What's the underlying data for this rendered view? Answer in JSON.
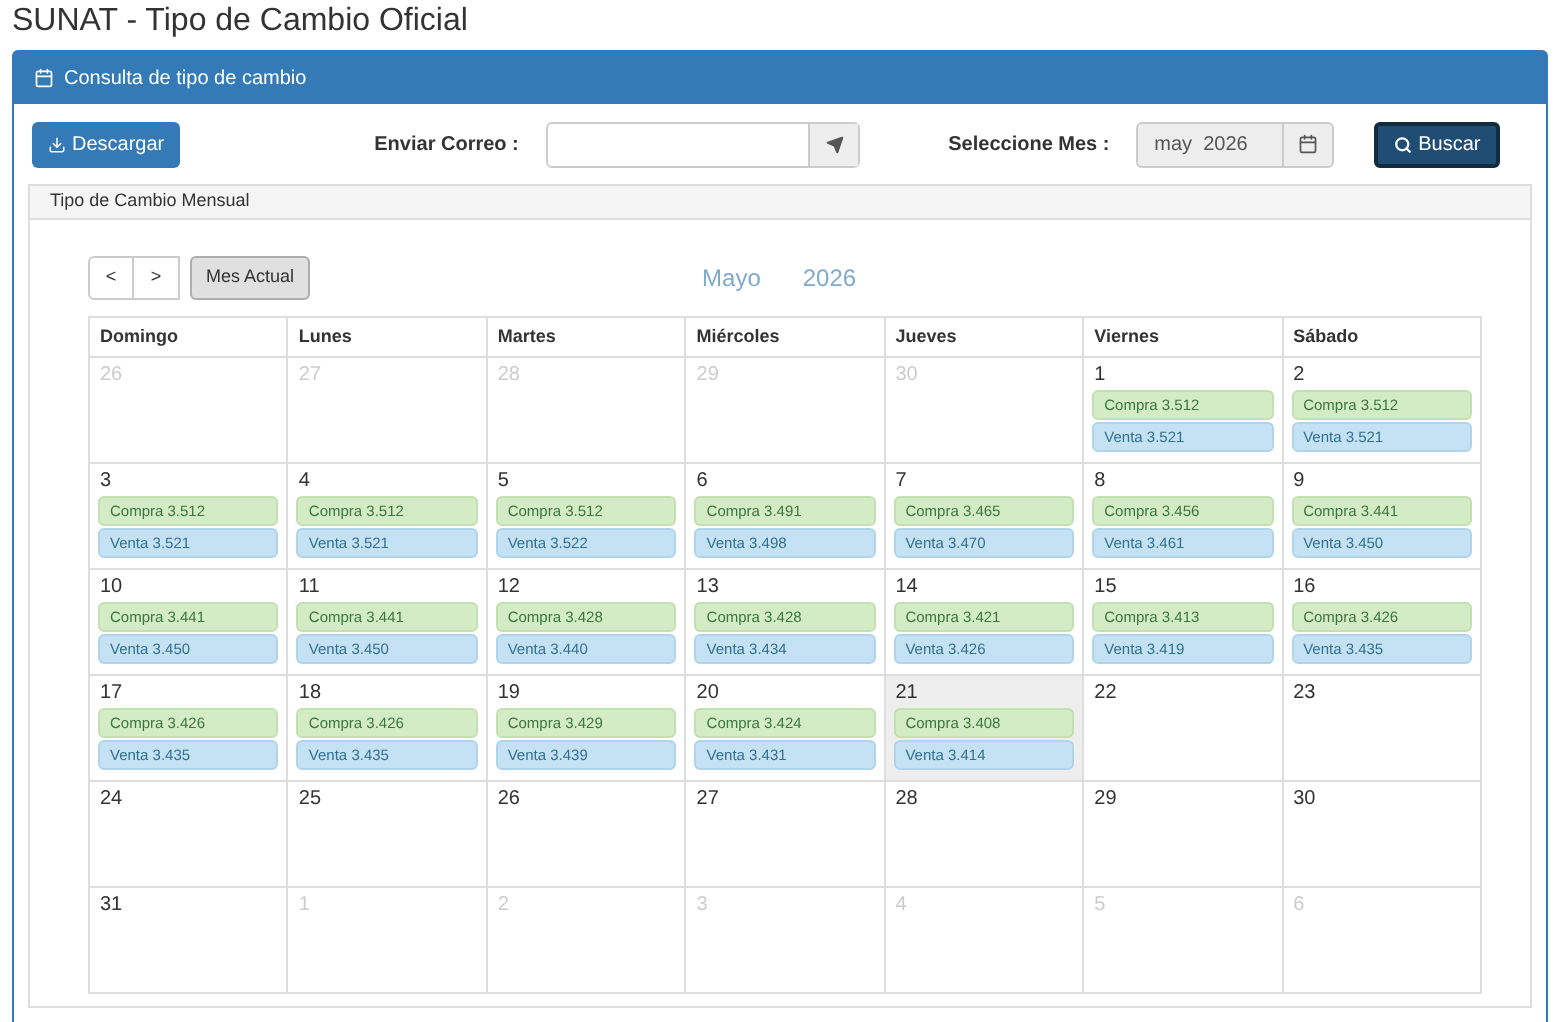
{
  "page_title": "SUNAT - Tipo de Cambio Oficial",
  "panel": {
    "title": "Consulta de tipo de cambio"
  },
  "toolbar": {
    "download_button": "Descargar",
    "email_label": "Enviar Correo :",
    "month_label": "Seleccione Mes :",
    "month_field": {
      "value": "may  2026"
    },
    "search_button": "Buscar"
  },
  "calendar_panel": {
    "title": "Tipo de Cambio Mensual",
    "nav": {
      "prev": "<",
      "next": ">",
      "today": "Mes Actual"
    },
    "month": "Mayo",
    "year": "2026",
    "weekdays": [
      "Domingo",
      "Lunes",
      "Martes",
      "Miércoles",
      "Jueves",
      "Viernes",
      "Sábado"
    ],
    "weeks": [
      [
        {
          "day": "26",
          "other": true,
          "selected": false
        },
        {
          "day": "27",
          "other": true,
          "selected": false
        },
        {
          "day": "28",
          "other": true,
          "selected": false
        },
        {
          "day": "29",
          "other": true,
          "selected": false
        },
        {
          "day": "30",
          "other": true,
          "selected": false
        },
        {
          "day": "1",
          "other": false,
          "selected": false,
          "compra": "Compra 3.512",
          "venta": "Venta 3.521"
        },
        {
          "day": "2",
          "other": false,
          "selected": false,
          "compra": "Compra 3.512",
          "venta": "Venta 3.521"
        }
      ],
      [
        {
          "day": "3",
          "other": false,
          "selected": false,
          "compra": "Compra 3.512",
          "venta": "Venta 3.521"
        },
        {
          "day": "4",
          "other": false,
          "selected": false,
          "compra": "Compra 3.512",
          "venta": "Venta 3.521"
        },
        {
          "day": "5",
          "other": false,
          "selected": false,
          "compra": "Compra 3.512",
          "venta": "Venta 3.522"
        },
        {
          "day": "6",
          "other": false,
          "selected": false,
          "compra": "Compra 3.491",
          "venta": "Venta 3.498"
        },
        {
          "day": "7",
          "other": false,
          "selected": false,
          "compra": "Compra 3.465",
          "venta": "Venta 3.470"
        },
        {
          "day": "8",
          "other": false,
          "selected": false,
          "compra": "Compra 3.456",
          "venta": "Venta 3.461"
        },
        {
          "day": "9",
          "other": false,
          "selected": false,
          "compra": "Compra 3.441",
          "venta": "Venta 3.450"
        }
      ],
      [
        {
          "day": "10",
          "other": false,
          "selected": false,
          "compra": "Compra 3.441",
          "venta": "Venta 3.450"
        },
        {
          "day": "11",
          "other": false,
          "selected": false,
          "compra": "Compra 3.441",
          "venta": "Venta 3.450"
        },
        {
          "day": "12",
          "other": false,
          "selected": false,
          "compra": "Compra 3.428",
          "venta": "Venta 3.440"
        },
        {
          "day": "13",
          "other": false,
          "selected": false,
          "compra": "Compra 3.428",
          "venta": "Venta 3.434"
        },
        {
          "day": "14",
          "other": false,
          "selected": false,
          "compra": "Compra 3.421",
          "venta": "Venta 3.426"
        },
        {
          "day": "15",
          "other": false,
          "selected": false,
          "compra": "Compra 3.413",
          "venta": "Venta 3.419"
        },
        {
          "day": "16",
          "other": false,
          "selected": false,
          "compra": "Compra 3.426",
          "venta": "Venta 3.435"
        }
      ],
      [
        {
          "day": "17",
          "other": false,
          "selected": false,
          "compra": "Compra 3.426",
          "venta": "Venta 3.435"
        },
        {
          "day": "18",
          "other": false,
          "selected": false,
          "compra": "Compra 3.426",
          "venta": "Venta 3.435"
        },
        {
          "day": "19",
          "other": false,
          "selected": false,
          "compra": "Compra 3.429",
          "venta": "Venta 3.439"
        },
        {
          "day": "20",
          "other": false,
          "selected": false,
          "compra": "Compra 3.424",
          "venta": "Venta 3.431"
        },
        {
          "day": "21",
          "other": false,
          "selected": true,
          "compra": "Compra 3.408",
          "venta": "Venta 3.414"
        },
        {
          "day": "22",
          "other": false,
          "selected": false
        },
        {
          "day": "23",
          "other": false,
          "selected": false
        }
      ],
      [
        {
          "day": "24",
          "other": false,
          "selected": false
        },
        {
          "day": "25",
          "other": false,
          "selected": false
        },
        {
          "day": "26",
          "other": false,
          "selected": false
        },
        {
          "day": "27",
          "other": false,
          "selected": false
        },
        {
          "day": "28",
          "other": false,
          "selected": false
        },
        {
          "day": "29",
          "other": false,
          "selected": false
        },
        {
          "day": "30",
          "other": false,
          "selected": false
        }
      ],
      [
        {
          "day": "31",
          "other": false,
          "selected": false
        },
        {
          "day": "1",
          "other": true,
          "selected": false
        },
        {
          "day": "2",
          "other": true,
          "selected": false
        },
        {
          "day": "3",
          "other": true,
          "selected": false
        },
        {
          "day": "4",
          "other": true,
          "selected": false
        },
        {
          "day": "5",
          "other": true,
          "selected": false
        },
        {
          "day": "6",
          "other": true,
          "selected": false
        }
      ]
    ]
  }
}
